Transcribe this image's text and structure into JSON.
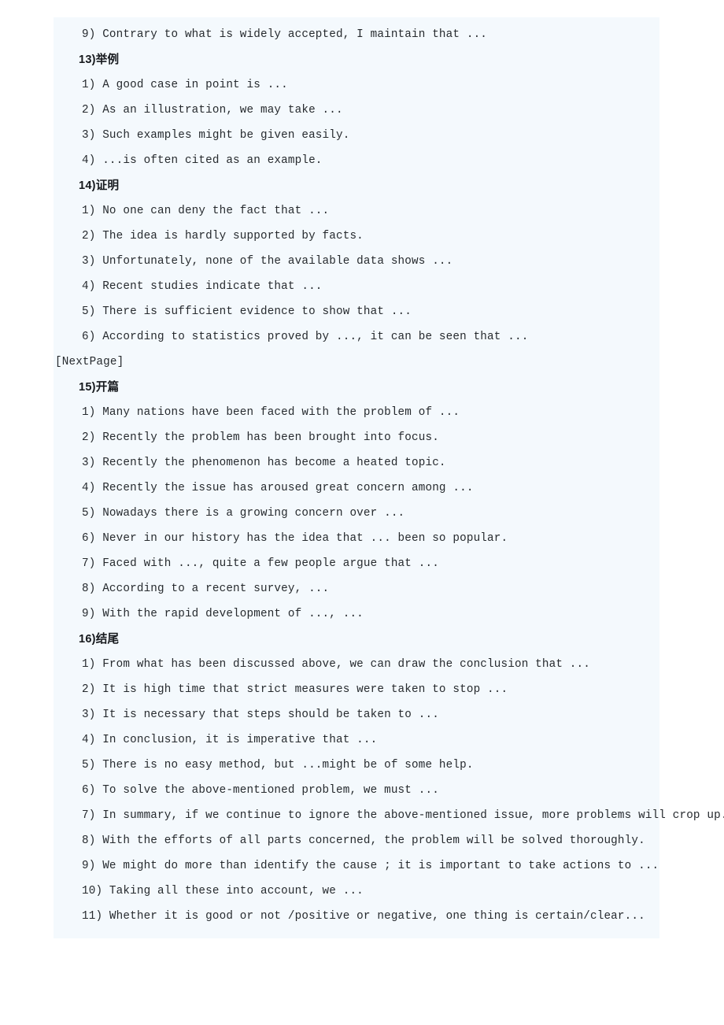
{
  "document": {
    "panel_background": "#f4f9fd",
    "text_color": "#262a2e",
    "blocks": [
      {
        "kind": "item",
        "text": "9) Contrary to what is widely accepted, I maintain that ..."
      },
      {
        "kind": "heading",
        "text": "13)举例"
      },
      {
        "kind": "item",
        "text": "1) A good case in point is ..."
      },
      {
        "kind": "item",
        "text": "2) As an illustration, we may take ..."
      },
      {
        "kind": "item",
        "text": "3) Such examples might be given easily."
      },
      {
        "kind": "item",
        "text": "4) ...is often cited as an example."
      },
      {
        "kind": "heading",
        "text": "14)证明"
      },
      {
        "kind": "item",
        "text": "1) No one can deny the fact that ..."
      },
      {
        "kind": "item",
        "text": "2) The idea is hardly supported by facts."
      },
      {
        "kind": "item",
        "text": "3) Unfortunately, none of the available data shows ..."
      },
      {
        "kind": "item",
        "text": "4) Recent studies indicate that ..."
      },
      {
        "kind": "item",
        "text": "5) There is sufficient evidence to show that ..."
      },
      {
        "kind": "item",
        "text": "6) According to statistics proved by ..., it can be seen that ..."
      },
      {
        "kind": "nextpage",
        "text": "[NextPage]"
      },
      {
        "kind": "heading",
        "text": "15)开篇"
      },
      {
        "kind": "item",
        "text": "1) Many nations have been faced with the problem of ..."
      },
      {
        "kind": "item",
        "text": "2) Recently the problem has been brought into focus."
      },
      {
        "kind": "item",
        "text": "3) Recently the phenomenon has become a heated topic."
      },
      {
        "kind": "item",
        "text": "4) Recently the issue has aroused great concern among ..."
      },
      {
        "kind": "item",
        "text": "5) Nowadays there is a growing concern over ..."
      },
      {
        "kind": "item",
        "text": "6) Never in our history has the idea that ... been so popular."
      },
      {
        "kind": "item",
        "text": "7) Faced with ..., quite a few people argue that ..."
      },
      {
        "kind": "item",
        "text": "8) According to a recent survey, ..."
      },
      {
        "kind": "item",
        "text": "9) With the rapid development of ..., ..."
      },
      {
        "kind": "heading",
        "text": "16)结尾"
      },
      {
        "kind": "item",
        "text": "1) From what has been discussed above, we can draw the conclusion that ..."
      },
      {
        "kind": "item",
        "text": "2) It is high time that strict measures were taken to stop ..."
      },
      {
        "kind": "item",
        "text": "3) It is necessary that steps should be taken to ..."
      },
      {
        "kind": "item",
        "text": "4) In conclusion, it is imperative that ..."
      },
      {
        "kind": "item",
        "text": "5) There is no easy method, but ...might be of some help."
      },
      {
        "kind": "item",
        "text": "6) To solve the above-mentioned problem, we must ..."
      },
      {
        "kind": "item",
        "text": "7) In summary, if we continue to ignore the above-mentioned issue, more problems will crop up."
      },
      {
        "kind": "item",
        "text": "8) With the efforts of all parts concerned, the problem will be solved thoroughly."
      },
      {
        "kind": "item",
        "text": "9) We might do more than identify the cause ; it is important to take actions to ..."
      },
      {
        "kind": "item",
        "text": "10) Taking all these into account, we ..."
      },
      {
        "kind": "item",
        "text": "11) Whether it is good or not /positive or negative, one thing is certain/clear..."
      }
    ]
  }
}
